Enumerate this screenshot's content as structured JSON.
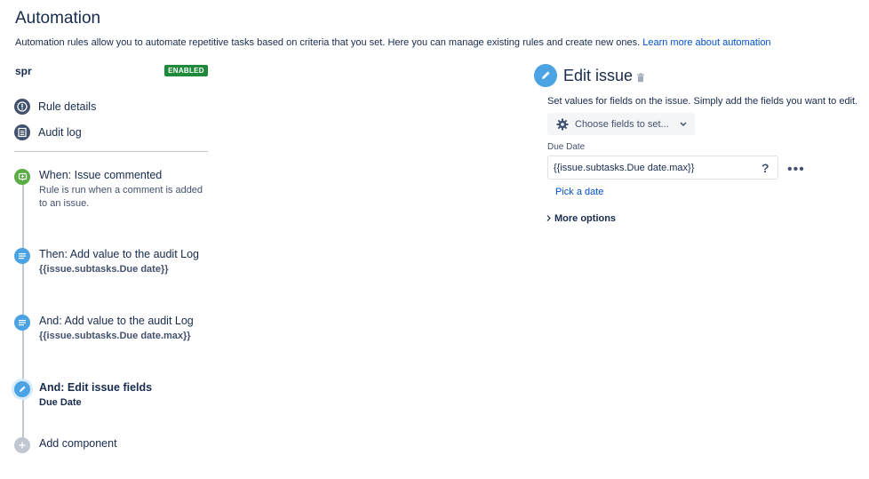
{
  "page": {
    "title": "Automation",
    "intro": "Automation rules allow you to automate repetitive tasks based on criteria that you set. Here you can manage existing rules and create new ones.",
    "learn_more": "Learn more about automation"
  },
  "rule": {
    "name": "spr",
    "status": "ENABLED"
  },
  "nav": [
    {
      "label": "Rule details",
      "icon": "info-icon"
    },
    {
      "label": "Audit log",
      "icon": "log-icon"
    }
  ],
  "steps": [
    {
      "title": "When: Issue commented",
      "sub": "Rule is run when a comment is added to an issue.",
      "icon": "comment-trigger-icon",
      "color": "#5aac44"
    },
    {
      "title": "Then: Add value to the audit Log",
      "sub": "{{issue.subtasks.Due date}}",
      "icon": "list-icon",
      "color": "#4ba3e3"
    },
    {
      "title": "And: Add value to the audit Log",
      "sub": "{{issue.subtasks.Due date.max}}",
      "icon": "list-icon",
      "color": "#4ba3e3"
    },
    {
      "title": "And: Edit issue fields",
      "sub": "Due Date",
      "icon": "pencil-icon",
      "color": "#4ba3e3"
    },
    {
      "title": "Add component",
      "icon": "plus-icon",
      "color": "#c1c7d0"
    }
  ],
  "edit": {
    "title": "Edit issue",
    "description": "Set values for fields on the issue. Simply add the fields you want to edit.",
    "choose_fields": "Choose fields to set...",
    "due_label": "Due Date",
    "due_value": "{{issue.subtasks.Due date.max}}",
    "help": "?",
    "more": "•••",
    "pick_date": "Pick a date",
    "more_options": "More options"
  }
}
